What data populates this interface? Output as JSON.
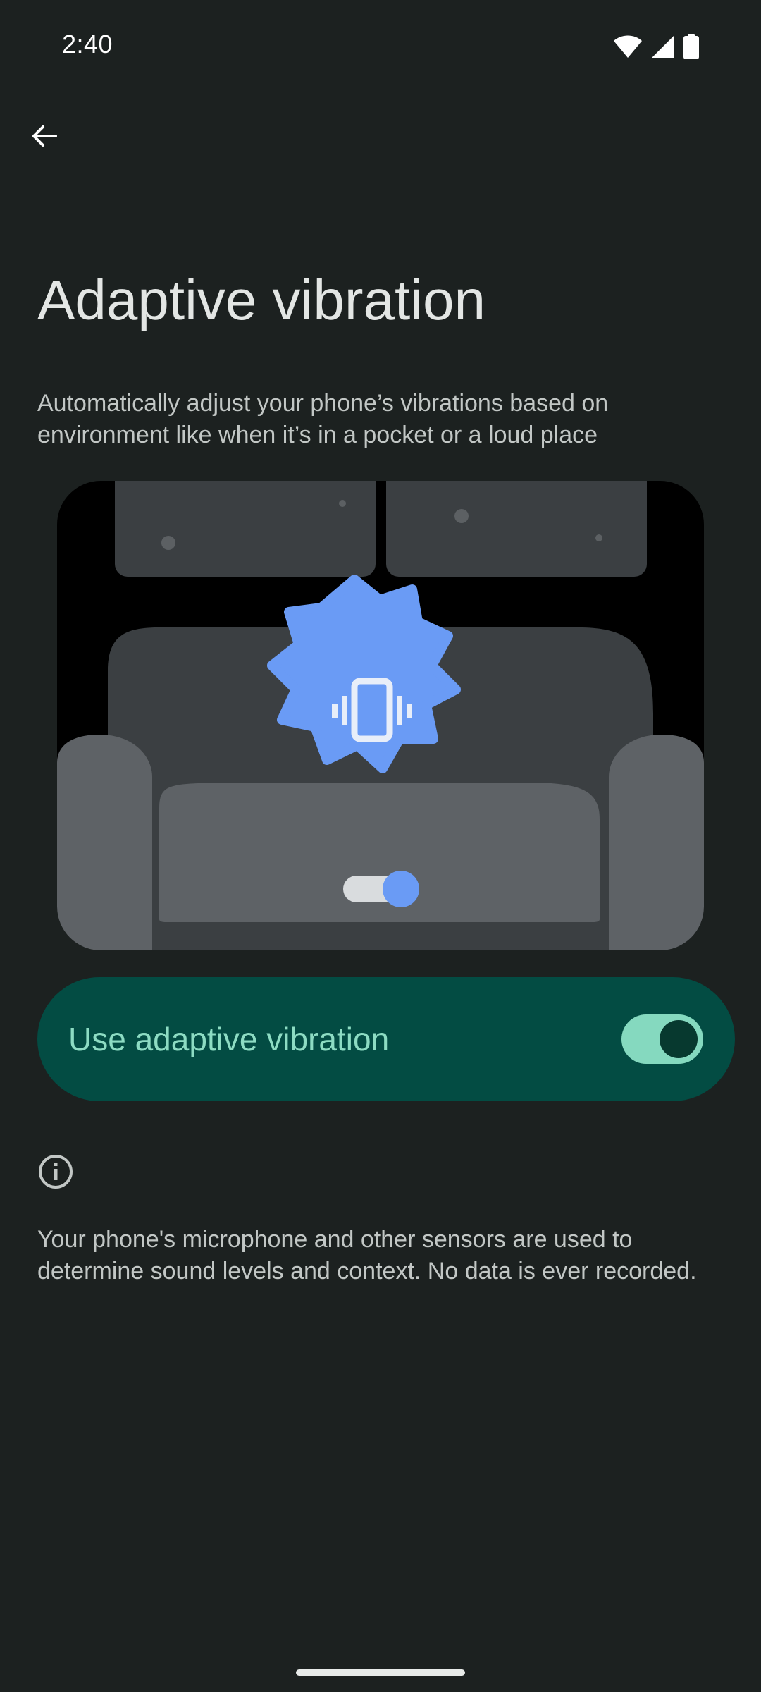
{
  "status_bar": {
    "time": "2:40",
    "icons": [
      "wifi-icon",
      "cellular-signal-icon",
      "battery-icon"
    ]
  },
  "header": {
    "back_icon": "arrow-back-icon"
  },
  "main": {
    "title": "Adaptive vibration",
    "description": "Automatically adjust your phone’s vibrations based on environment like when it’s in a pocket or a loud place",
    "illustration": {
      "subject": "couch-with-vibrating-phone",
      "icon": "vibration-icon",
      "accent_color": "#6a9bf5"
    },
    "toggle": {
      "label": "Use adaptive vibration",
      "state": "on",
      "card_color": "#034c43",
      "label_color": "#8ddcc3",
      "track_color": "#85d9bf"
    },
    "info": {
      "icon": "info-icon",
      "text": "Your phone's microphone and other sensors are used to determine sound levels and context. No data is ever recorded."
    }
  },
  "colors": {
    "background": "#1c2120",
    "text_primary": "#e3e6e4",
    "text_secondary": "#c2c7c5"
  }
}
